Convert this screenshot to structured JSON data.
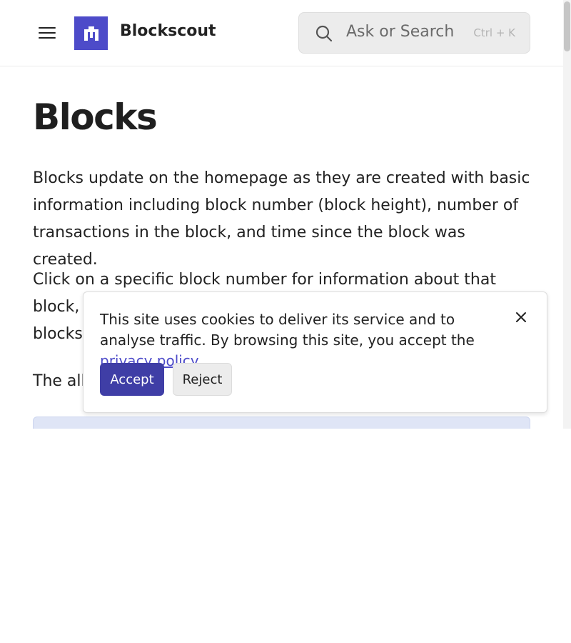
{
  "header": {
    "brand": "Blockscout",
    "search_placeholder": "Ask or Search",
    "search_shortcut": "Ctrl + K"
  },
  "content": {
    "title": "Blocks",
    "paragraphs": [
      "Blocks update on the homepage as they are created with basic information including block number (block height), number of transactions in the block, and time since the block was created.",
      "Click on a specific block number for information about that block, or click on Blocks to see more information about all blocks.",
      "The all"
    ]
  },
  "cookie_banner": {
    "text_before_link": "This site uses cookies to deliver its service and to analyse traffic. By browsing this site, you accept the ",
    "link_text": "privacy policy",
    "text_after_link": ".",
    "accept_label": "Accept",
    "reject_label": "Reject"
  },
  "colors": {
    "brand": "#4d4bc9",
    "accept_button": "#3f3ea6",
    "search_bg": "#ececec",
    "info_box": "#dfe5f6"
  },
  "icons": {
    "menu": "hamburger-menu-icon",
    "logo": "blockscout-logo-icon",
    "search": "search-icon",
    "close": "close-icon"
  }
}
